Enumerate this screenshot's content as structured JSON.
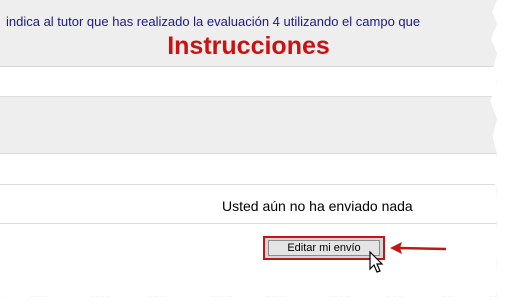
{
  "header": {
    "instruction_line": "indica al tutor que has realizado la evaluación 4 utilizando el campo que",
    "title": "Instrucciones"
  },
  "submission": {
    "status_text": "Usted aún no ha enviado nada",
    "edit_button_label": "Editar mi envío"
  },
  "colors": {
    "title": "#cc1111",
    "instruction_text": "#1a1a8a",
    "highlight": "#c01818"
  },
  "icons": {
    "arrow": "red-arrow-icon",
    "cursor": "mouse-pointer-icon"
  }
}
